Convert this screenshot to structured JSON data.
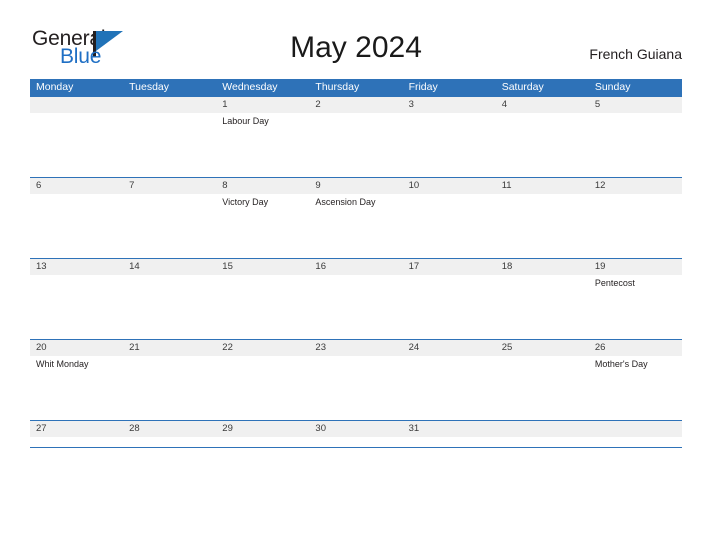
{
  "brand": {
    "name_part1": "General",
    "name_part2": "Blue",
    "flag_icon": "flag-triangle-icon",
    "accent_color": "#2e72b8"
  },
  "header": {
    "title": "May 2024",
    "location": "French Guiana"
  },
  "calendar": {
    "month": "May",
    "year": "2024",
    "weekday_headers": [
      "Monday",
      "Tuesday",
      "Wednesday",
      "Thursday",
      "Friday",
      "Saturday",
      "Sunday"
    ],
    "header_bg": "#2e72b8",
    "header_text_color": "#ffffff",
    "row_band_color": "#f0f0f0",
    "row_border_color": "#2e72b8",
    "weeks": [
      {
        "days": [
          {
            "num": "",
            "event": ""
          },
          {
            "num": "",
            "event": ""
          },
          {
            "num": "1",
            "event": "Labour Day"
          },
          {
            "num": "2",
            "event": ""
          },
          {
            "num": "3",
            "event": ""
          },
          {
            "num": "4",
            "event": ""
          },
          {
            "num": "5",
            "event": ""
          }
        ]
      },
      {
        "days": [
          {
            "num": "6",
            "event": ""
          },
          {
            "num": "7",
            "event": ""
          },
          {
            "num": "8",
            "event": "Victory Day"
          },
          {
            "num": "9",
            "event": "Ascension Day"
          },
          {
            "num": "10",
            "event": ""
          },
          {
            "num": "11",
            "event": ""
          },
          {
            "num": "12",
            "event": ""
          }
        ]
      },
      {
        "days": [
          {
            "num": "13",
            "event": ""
          },
          {
            "num": "14",
            "event": ""
          },
          {
            "num": "15",
            "event": ""
          },
          {
            "num": "16",
            "event": ""
          },
          {
            "num": "17",
            "event": ""
          },
          {
            "num": "18",
            "event": ""
          },
          {
            "num": "19",
            "event": "Pentecost"
          }
        ]
      },
      {
        "days": [
          {
            "num": "20",
            "event": "Whit Monday"
          },
          {
            "num": "21",
            "event": ""
          },
          {
            "num": "22",
            "event": ""
          },
          {
            "num": "23",
            "event": ""
          },
          {
            "num": "24",
            "event": ""
          },
          {
            "num": "25",
            "event": ""
          },
          {
            "num": "26",
            "event": "Mother's Day"
          }
        ]
      },
      {
        "days": [
          {
            "num": "27",
            "event": ""
          },
          {
            "num": "28",
            "event": ""
          },
          {
            "num": "29",
            "event": ""
          },
          {
            "num": "30",
            "event": ""
          },
          {
            "num": "31",
            "event": ""
          },
          {
            "num": "",
            "event": ""
          },
          {
            "num": "",
            "event": ""
          }
        ]
      }
    ]
  }
}
